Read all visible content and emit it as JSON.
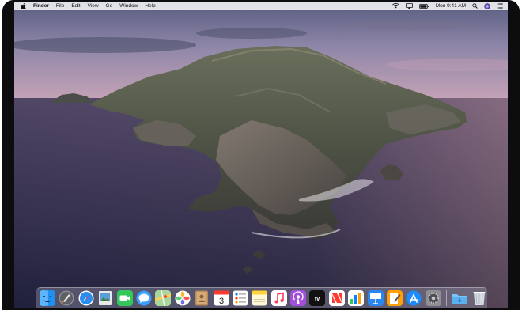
{
  "menubar": {
    "apple_icon": "apple-logo-icon",
    "app_name": "Finder",
    "items": [
      "File",
      "Edit",
      "View",
      "Go",
      "Window",
      "Help"
    ],
    "status_icons": [
      "wifi-icon",
      "airplay-icon",
      "battery-icon",
      "search-icon",
      "siri-icon",
      "notification-center-icon"
    ],
    "clock": "Mon 9:41 AM"
  },
  "dock": {
    "apps": [
      {
        "name": "finder",
        "icon": "finder-icon"
      },
      {
        "name": "launchpad",
        "icon": "launchpad-icon"
      },
      {
        "name": "safari",
        "icon": "safari-icon"
      },
      {
        "name": "photos-preview",
        "icon": "preview-icon"
      },
      {
        "name": "facetime",
        "icon": "facetime-icon"
      },
      {
        "name": "messages",
        "icon": "messages-icon"
      },
      {
        "name": "maps",
        "icon": "maps-icon"
      },
      {
        "name": "photos",
        "icon": "photos-icon"
      },
      {
        "name": "contacts",
        "icon": "contacts-icon"
      },
      {
        "name": "calendar",
        "icon": "calendar-icon",
        "label": "3"
      },
      {
        "name": "reminders",
        "icon": "reminders-icon"
      },
      {
        "name": "notes",
        "icon": "notes-icon"
      },
      {
        "name": "music",
        "icon": "music-icon"
      },
      {
        "name": "podcasts",
        "icon": "podcasts-icon"
      },
      {
        "name": "apple-tv",
        "icon": "tv-icon",
        "label": "tv"
      },
      {
        "name": "news",
        "icon": "news-icon"
      },
      {
        "name": "numbers",
        "icon": "numbers-icon"
      },
      {
        "name": "keynote",
        "icon": "keynote-icon"
      },
      {
        "name": "pages",
        "icon": "pages-icon"
      },
      {
        "name": "app-store",
        "icon": "app-store-icon"
      },
      {
        "name": "system-preferences",
        "icon": "system-preferences-icon"
      }
    ],
    "extras": [
      {
        "name": "downloads-folder",
        "icon": "folder-icon"
      },
      {
        "name": "trash",
        "icon": "trash-icon"
      }
    ]
  }
}
